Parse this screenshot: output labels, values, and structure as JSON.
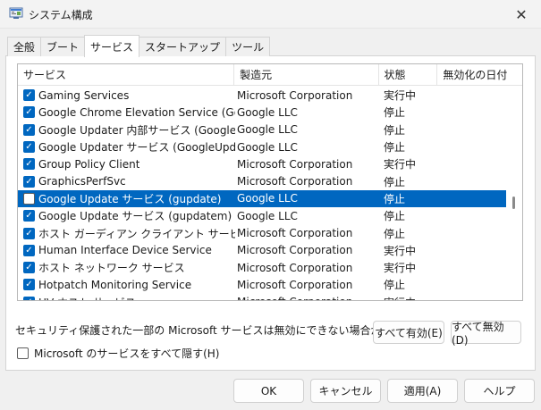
{
  "window": {
    "title": "システム構成",
    "close_glyph": "✕"
  },
  "tabs": [
    {
      "label": "全般"
    },
    {
      "label": "ブート"
    },
    {
      "label": "サービス"
    },
    {
      "label": "スタートアップ"
    },
    {
      "label": "ツール"
    }
  ],
  "active_tab": "サービス",
  "list": {
    "headers": {
      "service": "サービス",
      "manufacturer": "製造元",
      "status": "状態",
      "disabled_date": "無効化の日付"
    },
    "rows": [
      {
        "name": "Gaming Services",
        "maker": "Microsoft Corporation",
        "status": "実行中",
        "checked": true,
        "selected": false
      },
      {
        "name": "Google Chrome Elevation Service (GoogleChromeElevationService)",
        "maker": "Google LLC",
        "status": "停止",
        "checked": true,
        "selected": false
      },
      {
        "name": "Google Updater 内部サービス (GoogleUpdaterInternalService)",
        "maker": "Google LLC",
        "status": "停止",
        "checked": true,
        "selected": false
      },
      {
        "name": "Google Updater サービス (GoogleUpdaterService)",
        "maker": "Google LLC",
        "status": "停止",
        "checked": true,
        "selected": false
      },
      {
        "name": "Group Policy Client",
        "maker": "Microsoft Corporation",
        "status": "実行中",
        "checked": true,
        "selected": false
      },
      {
        "name": "GraphicsPerfSvc",
        "maker": "Microsoft Corporation",
        "status": "停止",
        "checked": true,
        "selected": false
      },
      {
        "name": "Google Update サービス (gupdate)",
        "maker": "Google LLC",
        "status": "停止",
        "checked": false,
        "selected": true
      },
      {
        "name": "Google Update サービス (gupdatem)",
        "maker": "Google LLC",
        "status": "停止",
        "checked": true,
        "selected": false
      },
      {
        "name": "ホスト ガーディアン クライアント サービス",
        "maker": "Microsoft Corporation",
        "status": "停止",
        "checked": true,
        "selected": false
      },
      {
        "name": "Human Interface Device Service",
        "maker": "Microsoft Corporation",
        "status": "実行中",
        "checked": true,
        "selected": false
      },
      {
        "name": "ホスト ネットワーク サービス",
        "maker": "Microsoft Corporation",
        "status": "実行中",
        "checked": true,
        "selected": false
      },
      {
        "name": "Hotpatch Monitoring Service",
        "maker": "Microsoft Corporation",
        "status": "停止",
        "checked": true,
        "selected": false
      },
      {
        "name": "HV ホスト サービス",
        "maker": "Microsoft Corporation",
        "status": "実行中",
        "checked": true,
        "selected": false
      }
    ]
  },
  "note": "セキュリティ保護された一部の Microsoft サービスは無効にできない場合があります。",
  "enable_all_label": "すべて有効(E)",
  "disable_all_label": "すべて無効(D)",
  "hide_ms_label": "Microsoft のサービスをすべて隠す(H)",
  "hide_ms_checked": false,
  "footer": {
    "ok": "OK",
    "cancel": "キャンセル",
    "apply": "適用(A)",
    "help": "ヘルプ"
  },
  "colors": {
    "accent": "#0067c0"
  },
  "icons": {
    "app": "msconfig-icon",
    "close": "close-icon",
    "check": "checkmark-icon"
  }
}
